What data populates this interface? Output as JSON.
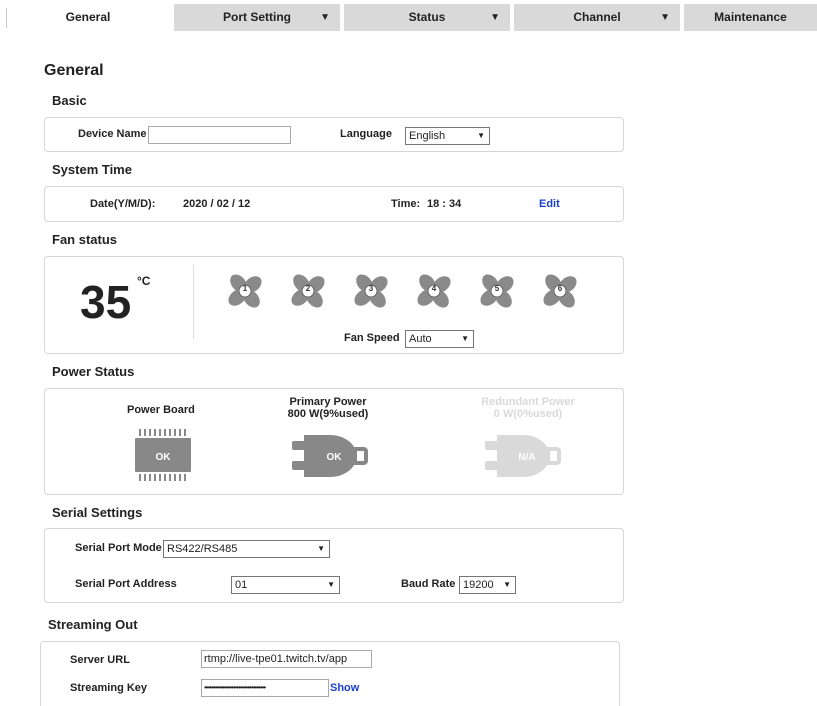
{
  "tabs": [
    {
      "label": "General"
    },
    {
      "label": "Port Setting"
    },
    {
      "label": "Status"
    },
    {
      "label": "Channel"
    },
    {
      "label": "Maintenance"
    }
  ],
  "page_title": "General",
  "basic": {
    "title": "Basic",
    "device_name_label": "Device Name",
    "device_name_value": "",
    "language_label": "Language",
    "language_value": "English"
  },
  "system_time": {
    "title": "System Time",
    "date_label": "Date(Y/M/D):",
    "date_value": "2020 / 02 / 12",
    "time_label": "Time:",
    "time_value": "18 : 34",
    "edit_label": "Edit"
  },
  "fan_status": {
    "title": "Fan status",
    "temperature": "35",
    "unit": "°C",
    "fans": [
      "1",
      "2",
      "3",
      "4",
      "5",
      "6"
    ],
    "fan_speed_label": "Fan Speed",
    "fan_speed_value": "Auto"
  },
  "power_status": {
    "title": "Power Status",
    "power_board_label": "Power Board",
    "power_board_state": "OK",
    "primary_label": "Primary Power",
    "primary_detail": "800 W(9%used)",
    "primary_state": "OK",
    "redundant_label": "Redundant Power",
    "redundant_detail": "0 W(0%used)",
    "redundant_state": "N/A",
    "colors": {
      "active": "#888888",
      "inactive": "#d9d9d9"
    }
  },
  "serial_settings": {
    "title": "Serial Settings",
    "mode_label": "Serial Port Mode",
    "mode_value": "RS422/RS485",
    "address_label": "Serial Port Address",
    "address_value": "01",
    "baud_label": "Baud Rate",
    "baud_value": "19200"
  },
  "streaming_out": {
    "title": "Streaming Out",
    "server_url_label": "Server URL",
    "server_url_value": "rtmp://live-tpe01.twitch.tv/app",
    "key_label": "Streaming Key",
    "key_value": "••••••••••••••••••••••••••••••••••",
    "show_label": "Show"
  }
}
